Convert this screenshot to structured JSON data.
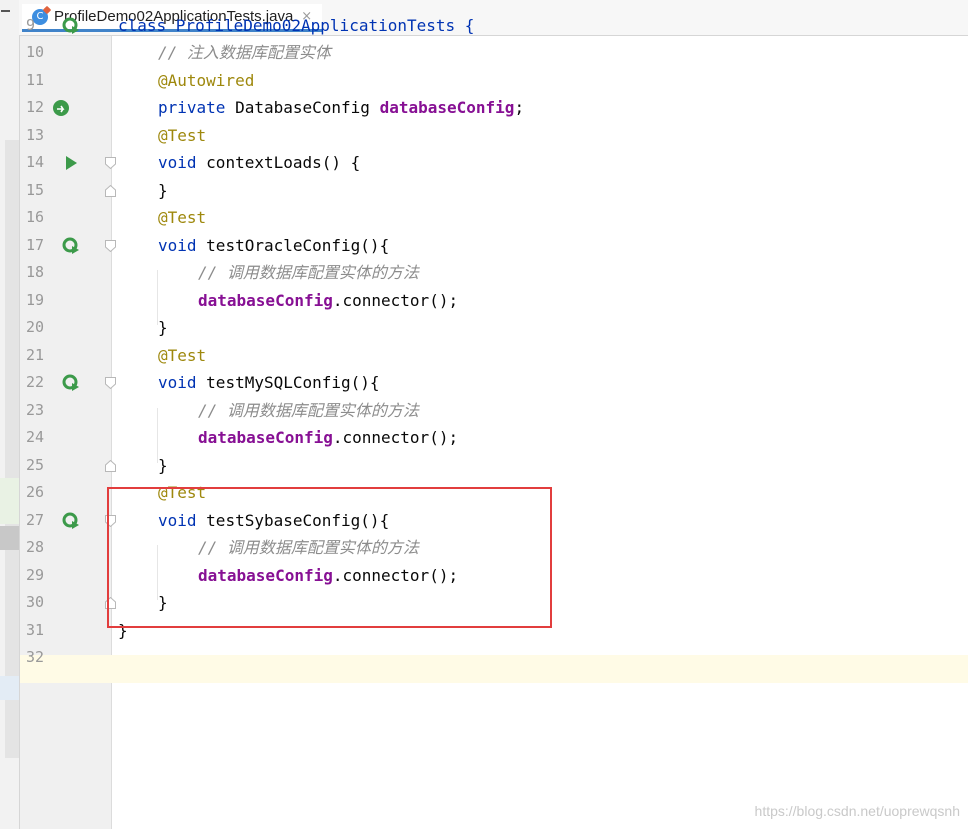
{
  "tab": {
    "filename": "ProfileDemo02ApplicationTests.java",
    "icon_letter": "C",
    "close_glyph": "×"
  },
  "lines": [
    {
      "num": "9",
      "code": "class ProfileDemo02ApplicationTests {"
    },
    {
      "num": "10",
      "comment": "// 注入数据库配置实体"
    },
    {
      "num": "11",
      "annotation": "@Autowired"
    },
    {
      "num": "12",
      "kw": "private",
      "type": "DatabaseConfig",
      "field": "databaseConfig",
      "end": ";"
    },
    {
      "num": "13",
      "annotation": "@Test"
    },
    {
      "num": "14",
      "kw": "void",
      "method": "contextLoads() {"
    },
    {
      "num": "15",
      "brace": "}"
    },
    {
      "num": "16",
      "annotation": "@Test"
    },
    {
      "num": "17",
      "kw": "void",
      "method": "testOracleConfig(){"
    },
    {
      "num": "18",
      "comment": "// 调用数据库配置实体的方法"
    },
    {
      "num": "19",
      "field": "databaseConfig",
      "call": ".connector();"
    },
    {
      "num": "20",
      "brace": "}"
    },
    {
      "num": "21",
      "annotation": "@Test"
    },
    {
      "num": "22",
      "kw": "void",
      "method": "testMySQLConfig(){"
    },
    {
      "num": "23",
      "comment": "// 调用数据库配置实体的方法"
    },
    {
      "num": "24",
      "field": "databaseConfig",
      "call": ".connector();"
    },
    {
      "num": "25",
      "brace": "}"
    },
    {
      "num": "26",
      "annotation": "@Test"
    },
    {
      "num": "27",
      "kw": "void",
      "method": "testSybaseConfig(){"
    },
    {
      "num": "28",
      "comment": "// 调用数据库配置实体的方法"
    },
    {
      "num": "29",
      "field": "databaseConfig",
      "call": ".connector();"
    },
    {
      "num": "30",
      "brace": "}"
    },
    {
      "num": "31",
      "brace": "}"
    },
    {
      "num": "32"
    }
  ],
  "watermark": "https://blog.csdn.net/uoprewqsnh",
  "colors": {
    "keyword": "#0033b3",
    "annotation": "#9e880d",
    "field": "#871094",
    "comment": "#8c8c8c",
    "highlight_box": "#e23d3d",
    "run_icon": "#3c9a4a"
  }
}
